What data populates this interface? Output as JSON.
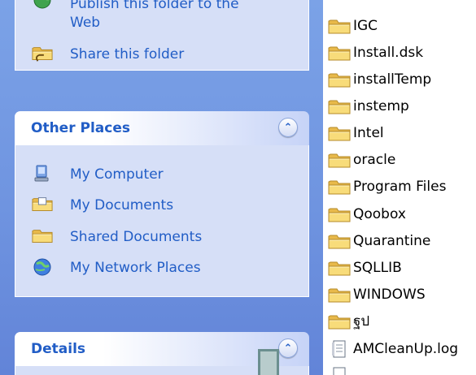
{
  "file_tasks_panel": {
    "items": [
      {
        "label": "Publish this folder to the",
        "label2": "Web",
        "icon": "globe-upload-icon"
      },
      {
        "label": "Share this folder",
        "icon": "share-folder-icon"
      }
    ]
  },
  "other_places": {
    "title": "Other Places",
    "collapse_glyph": "⌃",
    "items": [
      {
        "label": "My Computer",
        "icon": "my-computer-icon"
      },
      {
        "label": "My Documents",
        "icon": "my-documents-icon"
      },
      {
        "label": "Shared Documents",
        "icon": "folder-icon"
      },
      {
        "label": "My Network Places",
        "icon": "network-places-icon"
      }
    ]
  },
  "details": {
    "title": "Details",
    "collapse_glyph": "⌃"
  },
  "files": [
    {
      "name": "IGC",
      "type": "folder"
    },
    {
      "name": "Install.dsk",
      "type": "folder"
    },
    {
      "name": "installTemp",
      "type": "folder"
    },
    {
      "name": "instemp",
      "type": "folder"
    },
    {
      "name": "Intel",
      "type": "folder"
    },
    {
      "name": "oracle",
      "type": "folder"
    },
    {
      "name": "Program Files",
      "type": "folder"
    },
    {
      "name": "Qoobox",
      "type": "folder"
    },
    {
      "name": "Quarantine",
      "type": "folder"
    },
    {
      "name": "SQLLIB",
      "type": "folder"
    },
    {
      "name": "WINDOWS",
      "type": "folder"
    },
    {
      "name": "ฐป",
      "type": "folder"
    },
    {
      "name": "AMCleanUp.log",
      "type": "log-file"
    }
  ],
  "colors": {
    "task_pane_bg": "#6f94e0",
    "link_blue": "#215dc6",
    "panel_body": "#d6dff7",
    "folder_yellow": "#f6d66a"
  }
}
